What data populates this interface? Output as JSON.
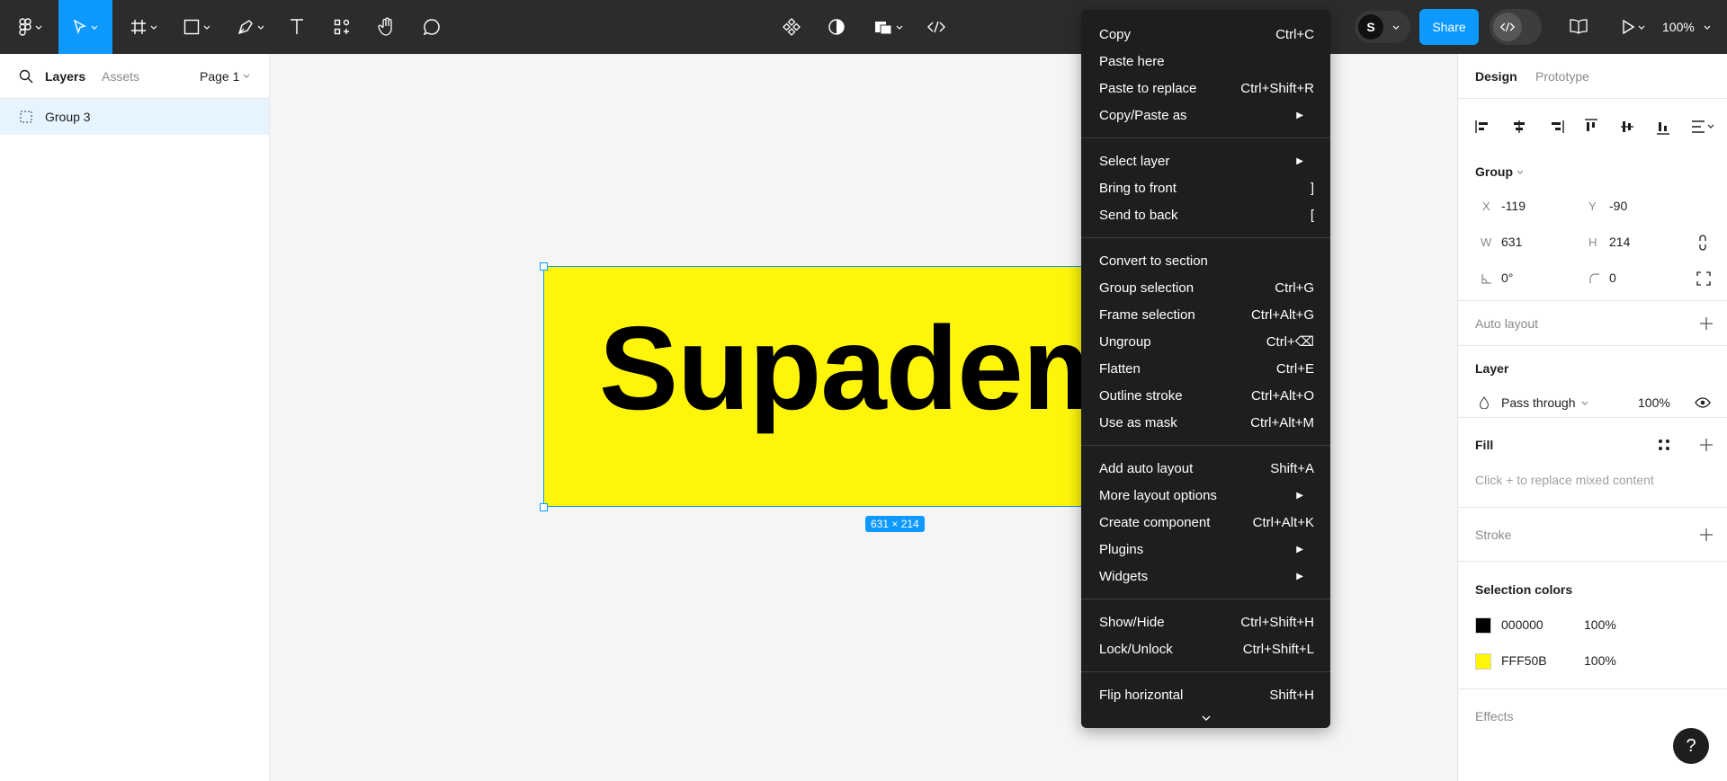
{
  "toolbar": {
    "zoom": "100%",
    "share_label": "Share",
    "avatar_initial": "S",
    "accent": "#0d99ff"
  },
  "left_panel": {
    "tabs": {
      "layers": "Layers",
      "assets": "Assets"
    },
    "page_selector": "Page 1",
    "layers": [
      {
        "name": "Group 3",
        "icon": "group-dashed-icon"
      }
    ]
  },
  "canvas": {
    "text": "Supadem",
    "rect_color": "#FFF50B",
    "size_badge": "631 × 214"
  },
  "context_menu": {
    "groups": [
      [
        {
          "label": "Copy",
          "shortcut": "Ctrl+C"
        },
        {
          "label": "Paste here",
          "shortcut": ""
        },
        {
          "label": "Paste to replace",
          "shortcut": "Ctrl+Shift+R"
        },
        {
          "label": "Copy/Paste as",
          "submenu": true
        }
      ],
      [
        {
          "label": "Select layer",
          "submenu": true
        },
        {
          "label": "Bring to front",
          "shortcut": "]"
        },
        {
          "label": "Send to back",
          "shortcut": "["
        }
      ],
      [
        {
          "label": "Convert to section",
          "shortcut": ""
        },
        {
          "label": "Group selection",
          "shortcut": "Ctrl+G"
        },
        {
          "label": "Frame selection",
          "shortcut": "Ctrl+Alt+G"
        },
        {
          "label": "Ungroup",
          "shortcut": "Ctrl+⌫"
        },
        {
          "label": "Flatten",
          "shortcut": "Ctrl+E"
        },
        {
          "label": "Outline stroke",
          "shortcut": "Ctrl+Alt+O"
        },
        {
          "label": "Use as mask",
          "shortcut": "Ctrl+Alt+M"
        }
      ],
      [
        {
          "label": "Add auto layout",
          "shortcut": "Shift+A"
        },
        {
          "label": "More layout options",
          "submenu": true
        },
        {
          "label": "Create component",
          "shortcut": "Ctrl+Alt+K"
        },
        {
          "label": "Plugins",
          "submenu": true
        },
        {
          "label": "Widgets",
          "submenu": true
        }
      ],
      [
        {
          "label": "Show/Hide",
          "shortcut": "Ctrl+Shift+H"
        },
        {
          "label": "Lock/Unlock",
          "shortcut": "Ctrl+Shift+L"
        }
      ],
      [
        {
          "label": "Flip horizontal",
          "shortcut": "Shift+H"
        }
      ]
    ]
  },
  "right_panel": {
    "tabs": {
      "design": "Design",
      "prototype": "Prototype"
    },
    "group": {
      "title": "Group",
      "x_label": "X",
      "x": "-119",
      "y_label": "Y",
      "y": "-90",
      "w_label": "W",
      "w": "631",
      "h_label": "H",
      "h": "214",
      "rotation": "0°",
      "radius": "0"
    },
    "auto_layout": "Auto layout",
    "layer": {
      "title": "Layer",
      "blend": "Pass through",
      "opacity": "100%"
    },
    "fill": {
      "title": "Fill",
      "placeholder": "Click + to replace mixed content"
    },
    "stroke": "Stroke",
    "selection_colors": {
      "title": "Selection colors",
      "items": [
        {
          "hex": "000000",
          "opacity": "100%",
          "color": "#000000"
        },
        {
          "hex": "FFF50B",
          "opacity": "100%",
          "color": "#FFF50B"
        }
      ]
    },
    "effects": "Effects"
  },
  "help": "?"
}
